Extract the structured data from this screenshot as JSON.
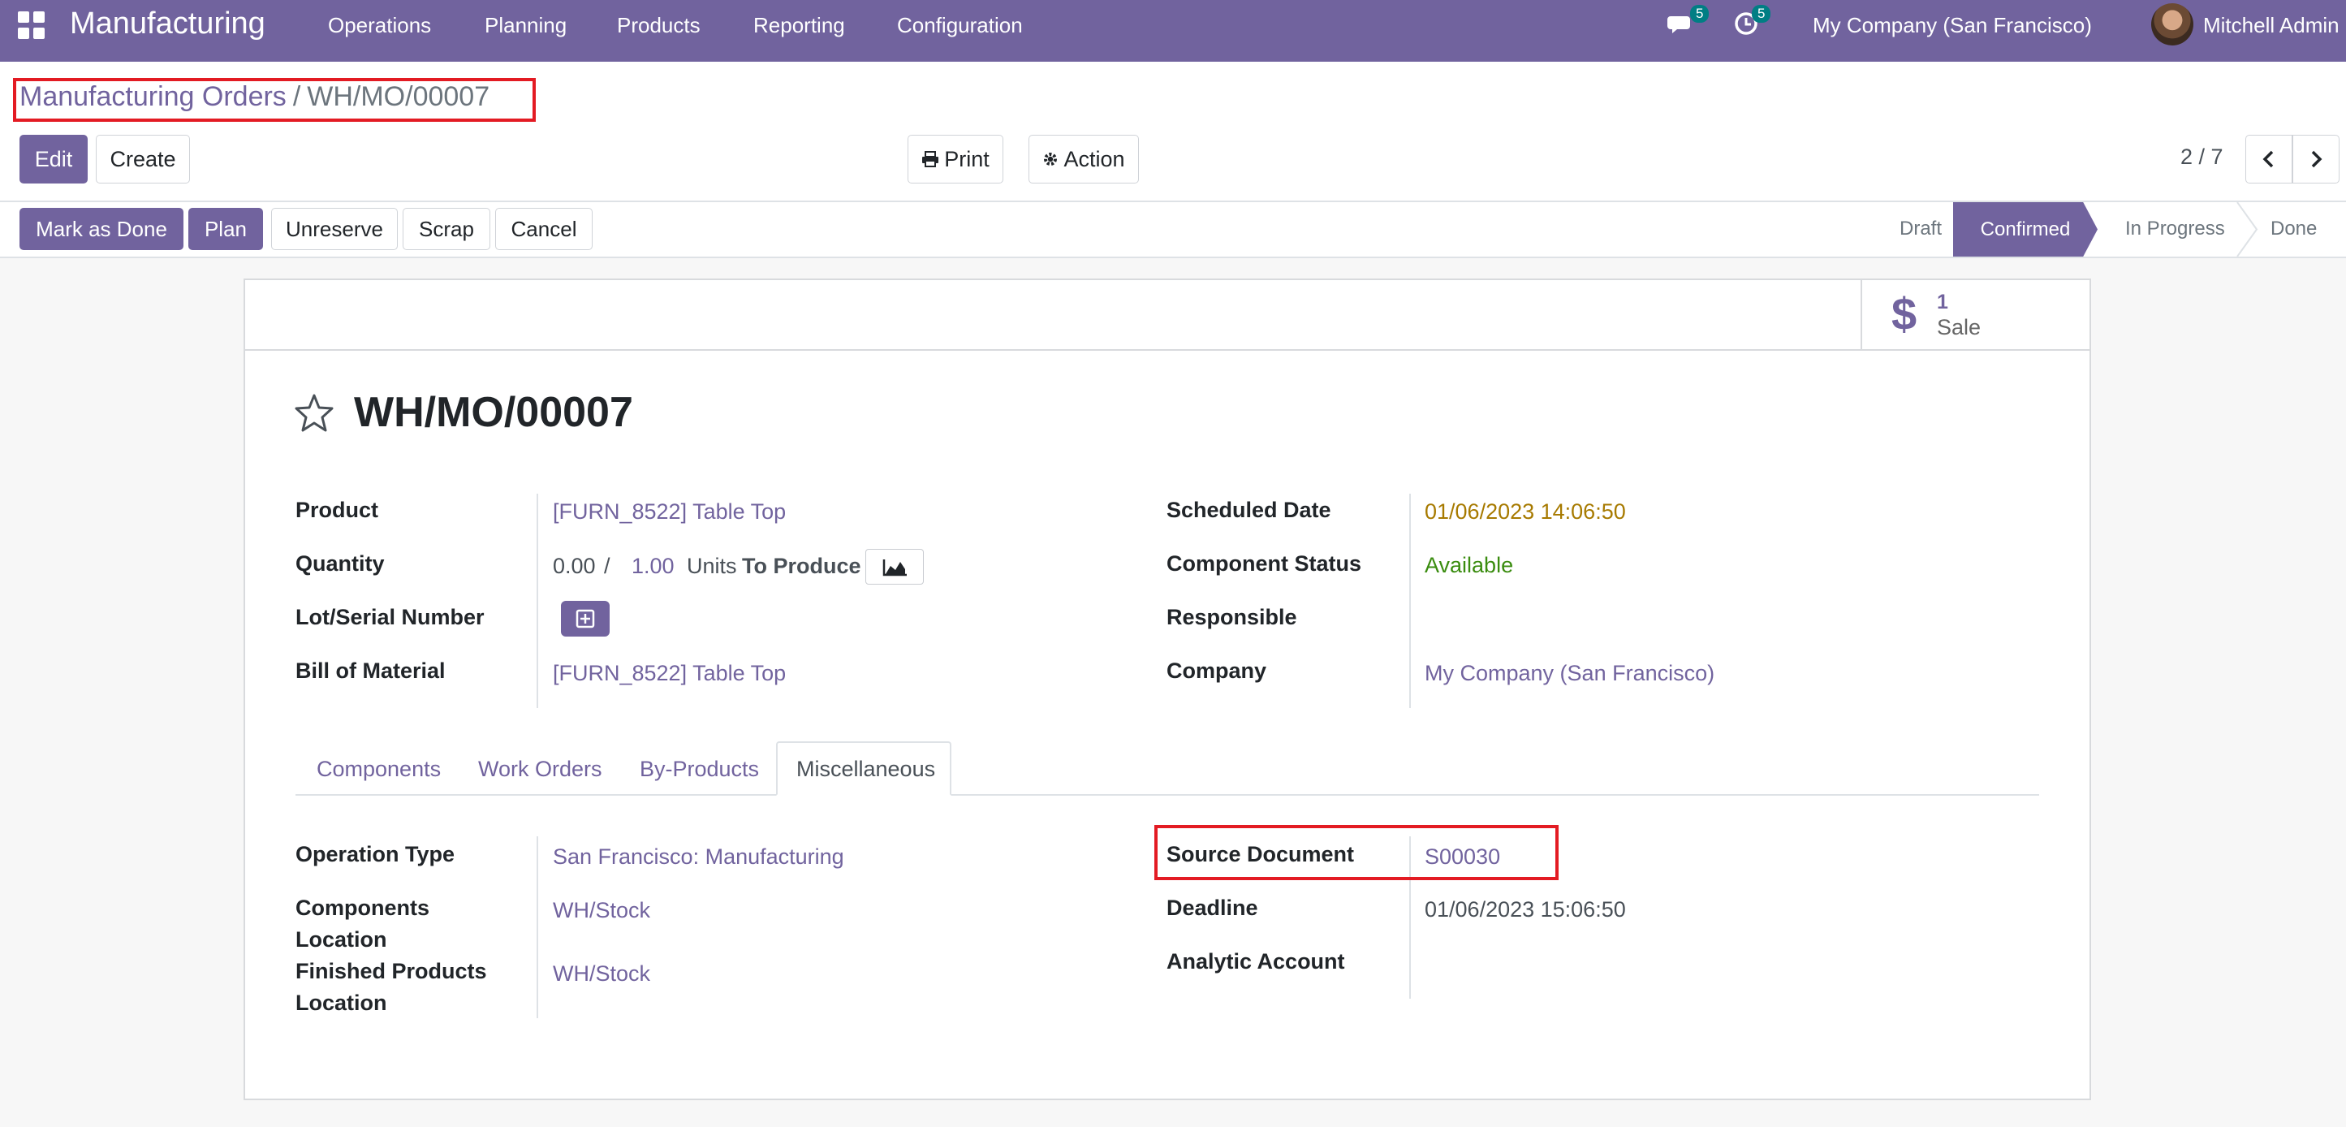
{
  "navbar": {
    "app_name": "Manufacturing",
    "menu": [
      "Operations",
      "Planning",
      "Products",
      "Reporting",
      "Configuration"
    ],
    "messages_count": "5",
    "activities_count": "5",
    "company": "My Company (San Francisco)",
    "user": "Mitchell Admin"
  },
  "breadcrumb": {
    "parent": "Manufacturing Orders",
    "separator": "/",
    "current": "WH/MO/00007"
  },
  "controls": {
    "edit": "Edit",
    "create": "Create",
    "print": "Print",
    "action": "Action",
    "pager": "2 / 7"
  },
  "statusbar": {
    "buttons": {
      "mark_done": "Mark as Done",
      "plan": "Plan",
      "unreserve": "Unreserve",
      "scrap": "Scrap",
      "cancel": "Cancel"
    },
    "steps": [
      "Draft",
      "Confirmed",
      "In Progress",
      "Done"
    ],
    "active_step": "Confirmed"
  },
  "smart_button": {
    "icon": "dollar-icon",
    "value": "1",
    "label": "Sale"
  },
  "record": {
    "title": "WH/MO/00007",
    "left_fields": {
      "product_label": "Product",
      "product_value": "[FURN_8522] Table Top",
      "quantity_label": "Quantity",
      "qty_produced": "0.00",
      "qty_sep": "/",
      "qty_total": "1.00",
      "qty_uom": "Units",
      "qty_to_produce": "To Produce",
      "lot_label": "Lot/Serial Number",
      "bom_label": "Bill of Material",
      "bom_value": "[FURN_8522] Table Top"
    },
    "right_fields": {
      "scheduled_label": "Scheduled Date",
      "scheduled_value": "01/06/2023 14:06:50",
      "component_status_label": "Component Status",
      "component_status_value": "Available",
      "responsible_label": "Responsible",
      "company_label": "Company",
      "company_value": "My Company (San Francisco)"
    }
  },
  "tabs": [
    "Components",
    "Work Orders",
    "By-Products",
    "Miscellaneous"
  ],
  "active_tab": "Miscellaneous",
  "misc": {
    "operation_type_label": "Operation Type",
    "operation_type_value": "San Francisco: Manufacturing",
    "components_location_label_1": "Components",
    "components_location_label_2": "Location",
    "components_location_value": "WH/Stock",
    "finished_location_label_1": "Finished Products",
    "finished_location_label_2": "Location",
    "finished_location_value": "WH/Stock",
    "source_document_label": "Source Document",
    "source_document_value": "S00030",
    "deadline_label": "Deadline",
    "deadline_value": "01/06/2023 15:06:50",
    "analytic_label": "Analytic Account"
  },
  "colors": {
    "brand": "#71639e",
    "highlight": "#e31b23",
    "warning": "#a77a00",
    "success": "#3a8c0f"
  }
}
